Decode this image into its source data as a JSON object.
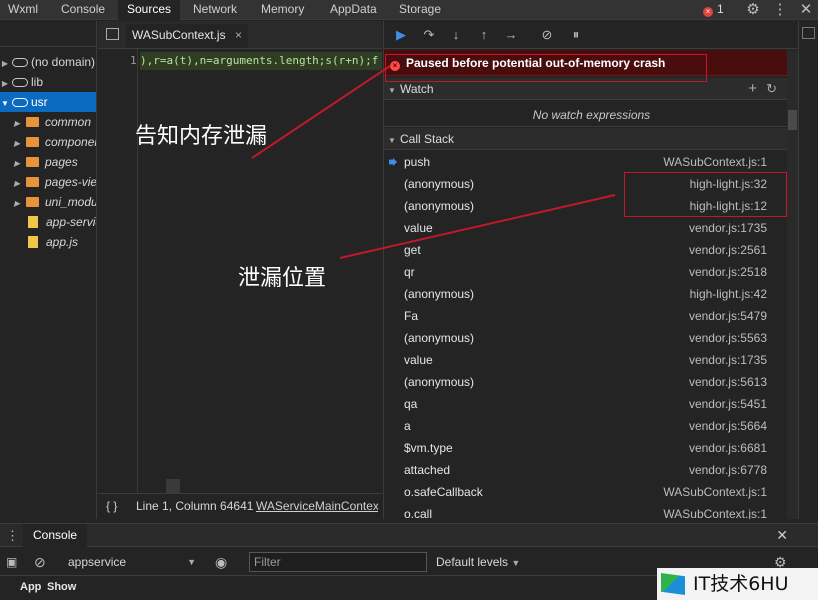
{
  "topbar": {
    "tabs": [
      "Wxml",
      "Console",
      "Sources",
      "Network",
      "Memory",
      "AppData",
      "Storage"
    ],
    "active_tab": "Sources",
    "error_count": "1",
    "error_glyph": "×",
    "icons": [
      "gear-icon",
      "more-vertical-icon",
      "close-icon"
    ]
  },
  "tree": {
    "items": [
      {
        "label": "(no domain)",
        "kind": "cloud",
        "selected": false
      },
      {
        "label": "lib",
        "kind": "cloud",
        "selected": false
      },
      {
        "label": "usr",
        "kind": "cloud",
        "selected": true
      },
      {
        "label": "common",
        "kind": "folder"
      },
      {
        "label": "componer",
        "kind": "folder"
      },
      {
        "label": "pages",
        "kind": "folder"
      },
      {
        "label": "pages-viev",
        "kind": "folder"
      },
      {
        "label": "uni_modu",
        "kind": "folder"
      },
      {
        "label": "app-servic",
        "kind": "file"
      },
      {
        "label": "app.js",
        "kind": "file"
      }
    ]
  },
  "editor": {
    "tab_label": "WASubContext.js",
    "line_number": "1",
    "code": "),r=a(t),n=arguments.length;s(r+n);f",
    "status_text": "Line 1, Column 64641",
    "status_link": "WAServiceMainContex",
    "braces": "{ }"
  },
  "debugger": {
    "paused_text": "Paused before potential out-of-memory crash",
    "paused_glyph": "×",
    "watch_title": "Watch",
    "no_watch": "No watch expressions",
    "callstack_title": "Call Stack",
    "frames": [
      {
        "fn": "push",
        "loc": "WASubContext.js:1",
        "current": true
      },
      {
        "fn": "(anonymous)",
        "loc": "high-light.js:32"
      },
      {
        "fn": "(anonymous)",
        "loc": "high-light.js:12"
      },
      {
        "fn": "value",
        "loc": "vendor.js:1735"
      },
      {
        "fn": "get",
        "loc": "vendor.js:2561"
      },
      {
        "fn": "qr",
        "loc": "vendor.js:2518"
      },
      {
        "fn": "(anonymous)",
        "loc": "high-light.js:42"
      },
      {
        "fn": "Fa",
        "loc": "vendor.js:5479"
      },
      {
        "fn": "(anonymous)",
        "loc": "vendor.js:5563"
      },
      {
        "fn": "value",
        "loc": "vendor.js:1735"
      },
      {
        "fn": "(anonymous)",
        "loc": "vendor.js:5613"
      },
      {
        "fn": "qa",
        "loc": "vendor.js:5451"
      },
      {
        "fn": "a",
        "loc": "vendor.js:5664"
      },
      {
        "fn": "$vm.type",
        "loc": "vendor.js:6681"
      },
      {
        "fn": "attached",
        "loc": "vendor.js:6778"
      },
      {
        "fn": "o.safeCallback",
        "loc": "WASubContext.js:1"
      },
      {
        "fn": "o.call",
        "loc": "WASubContext.js:1"
      }
    ]
  },
  "drawer": {
    "tab_label": "Console",
    "context": "appservice",
    "filter_placeholder": "Filter",
    "levels": "Default levels",
    "bottom_left": "App",
    "bottom_right": "Show"
  },
  "annotations": {
    "leak_notice": "告知内存泄漏",
    "leak_location": "泄漏位置",
    "color": "#c2182b"
  },
  "watermark": {
    "text": "IT技术6HU"
  }
}
